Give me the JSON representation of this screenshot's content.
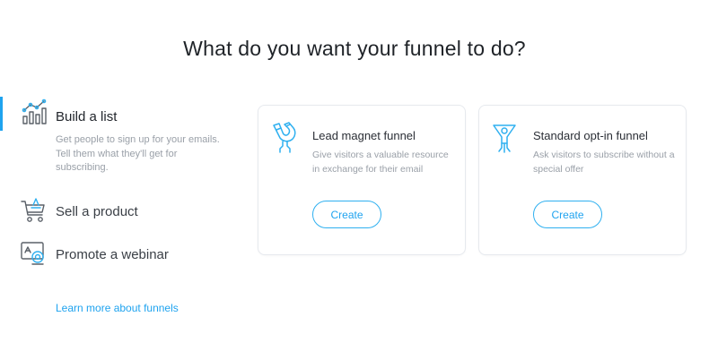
{
  "header": {
    "title": "What do you want your funnel to do?"
  },
  "sidebar": {
    "items": [
      {
        "label": "Build a list",
        "icon": "chart-growth-icon",
        "active": true,
        "description": "Get people to sign up for your emails. Tell them what they'll get for subscribing."
      },
      {
        "label": "Sell a product",
        "icon": "shopping-cart-icon",
        "active": false
      },
      {
        "label": "Promote a webinar",
        "icon": "webinar-icon",
        "active": false
      }
    ],
    "learn_more": "Learn more about funnels"
  },
  "cards": [
    {
      "title": "Lead magnet funnel",
      "icon": "magnet-icon",
      "description": "Give visitors a valuable resource in exchange for their email",
      "button_label": "Create"
    },
    {
      "title": "Standard opt-in funnel",
      "icon": "funnel-person-icon",
      "description": "Ask visitors to subscribe without a special offer",
      "button_label": "Create"
    }
  ],
  "colors": {
    "accent": "#1fa3ef",
    "icon_stroke": "#2fb0f0",
    "muted_text": "#9aa0a8",
    "sidebar_icon": "#5a6068"
  }
}
